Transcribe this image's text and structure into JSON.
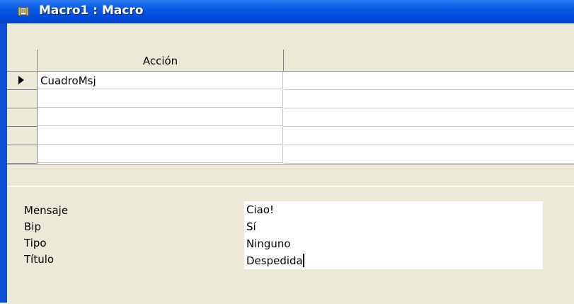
{
  "window": {
    "title": "Macro1 : Macro",
    "title_icon": "macro-scroll-icon"
  },
  "grid": {
    "columns": [
      "Acción",
      ""
    ],
    "rows": [
      {
        "accion": "CuadroMsj",
        "comentario": "",
        "current": true
      },
      {
        "accion": "",
        "comentario": ""
      },
      {
        "accion": "",
        "comentario": ""
      },
      {
        "accion": "",
        "comentario": ""
      },
      {
        "accion": "",
        "comentario": ""
      }
    ]
  },
  "properties": [
    {
      "label": "Mensaje",
      "value": "Ciao!"
    },
    {
      "label": "Bip",
      "value": "Sí"
    },
    {
      "label": "Tipo",
      "value": "Ninguno"
    },
    {
      "label": "Título",
      "value": "Despedida"
    }
  ],
  "colors": {
    "titlebar": "#0a5ce6",
    "panel": "#ece9d8"
  }
}
